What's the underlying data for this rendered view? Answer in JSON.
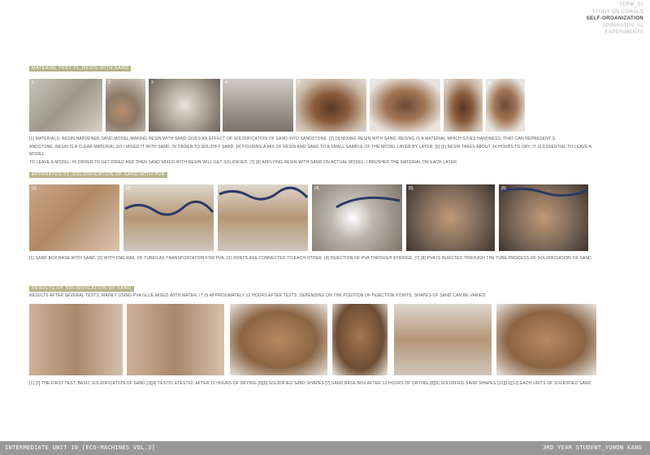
{
  "toc": {
    "items": [
      "TERM_01",
      "STUDY ON CORALS",
      "SELF-ORGANIZATION",
      "APPARATUS_01",
      "EXPERIMENTS"
    ]
  },
  "sections": [
    {
      "label": "MATERIAL TEST 01_RESIN WITH SAND",
      "photos": [
        {
          "num": "1"
        },
        {
          "num": "2"
        },
        {
          "num": "3"
        },
        {
          "num": "4"
        },
        {
          "num": "5"
        },
        {
          "num": "6"
        },
        {
          "num": "7"
        },
        {
          "num": "8"
        }
      ],
      "caption_lines": [
        "[1] MATERIALS: RESIN,HARDENER,SAND,MODEL,MAKING RESIN WITH SAND GIVES AN EFFECT OF SOLIDIFICATION OF SAND INTO SANDSTONE. [2] [3] MIXING RESIN WITH SAND, RESING IS A MATERIAL WHICH GIVES HARDNESS, THAT CAN REPRESENT S",
        "ANDSTONE. RESIN IS A CLEAR MATERIAL,SO I MIXED IT WITH SAND, IN ORDER TO SOLIDIFY SAND. [4] POURING A MIX OF RESIN AND SAND TO A SMALL SAMPLE OF THE MODEL LAYER BY LAYER. [5] [6] RESIN TAKES ABOUT 24 HOURS TO DRY, IT IS ESSENTIAL TO LEAVE A MODEL",
        "TO LEAVE A MODEL, IN ORDER TO GET DRIED AND THEN SAND MIXED WITH RESIN WILL GET SOLIDIFIED. [7] [8] APPLYING RESIN WITH SAND ON ACTUAL MODEL, I BRUSHED THE MATERIAL ON EACH LAYER."
      ]
    },
    {
      "label": "APPARATUS 01_SOLIDIFICATION OF SAND WITH PVA",
      "photos": [
        {
          "num": "[1]"
        },
        {
          "num": "[2]"
        },
        {
          "num": ""
        },
        {
          "num": "[4]"
        },
        {
          "num": "[5]"
        },
        {
          "num": "[6]"
        }
      ],
      "caption_lines": [
        "[1] SAND BOX BASE WITH SAND. [2] WITH ONE RAIL OF TUBES AS TRANSPORTATION FOR PVA. [3] JOINTS ARE CONNECTED TO EACH OTHER. [4] INJECTION OF PVA THROUGH SYRINGE. [7] [8] PVA IS INJECTED THROUGH THE TUBE,PROCESS OF SOLIDIFICATION OF SAND"
      ]
    },
    {
      "label": "RESULTS OF SOLIDIFICATION OF SAND",
      "intro": "RESULTS AFTER SEVERAL TESTS, MAINLY USING PVA GLUE MIXED WITH WATER, IT IS APPROXIMATELY 12 HOURS AFTER TESTS. DEPENDING ON THE POSITION OF INJECTION POINTS, SHAPES OF SAND CAN BE VARIED.",
      "caption_lines": [
        "[1] [2] THE FIRST TEST, BASIC SOLIDIFICATION OF SAND [3][4] TEST01 &TEST02, AFTER 12 HOURS OF DRYING [5][6] SOLIDIFIED SAND SHAPES [7] SAND BASE BOX AFTER 12 HOURS OF DRYING [8][9] SOLIDIFIED SAND SHAPES [10][11][12] EACH UNITS OF SOLIDIFIED SAND"
      ]
    }
  ],
  "footer": {
    "left": "INTERMEDIATE UNIT 10_[ECO-MACHINES VOL.3]",
    "right": "3RD YEAR STUDENT_YUWON KANG"
  }
}
